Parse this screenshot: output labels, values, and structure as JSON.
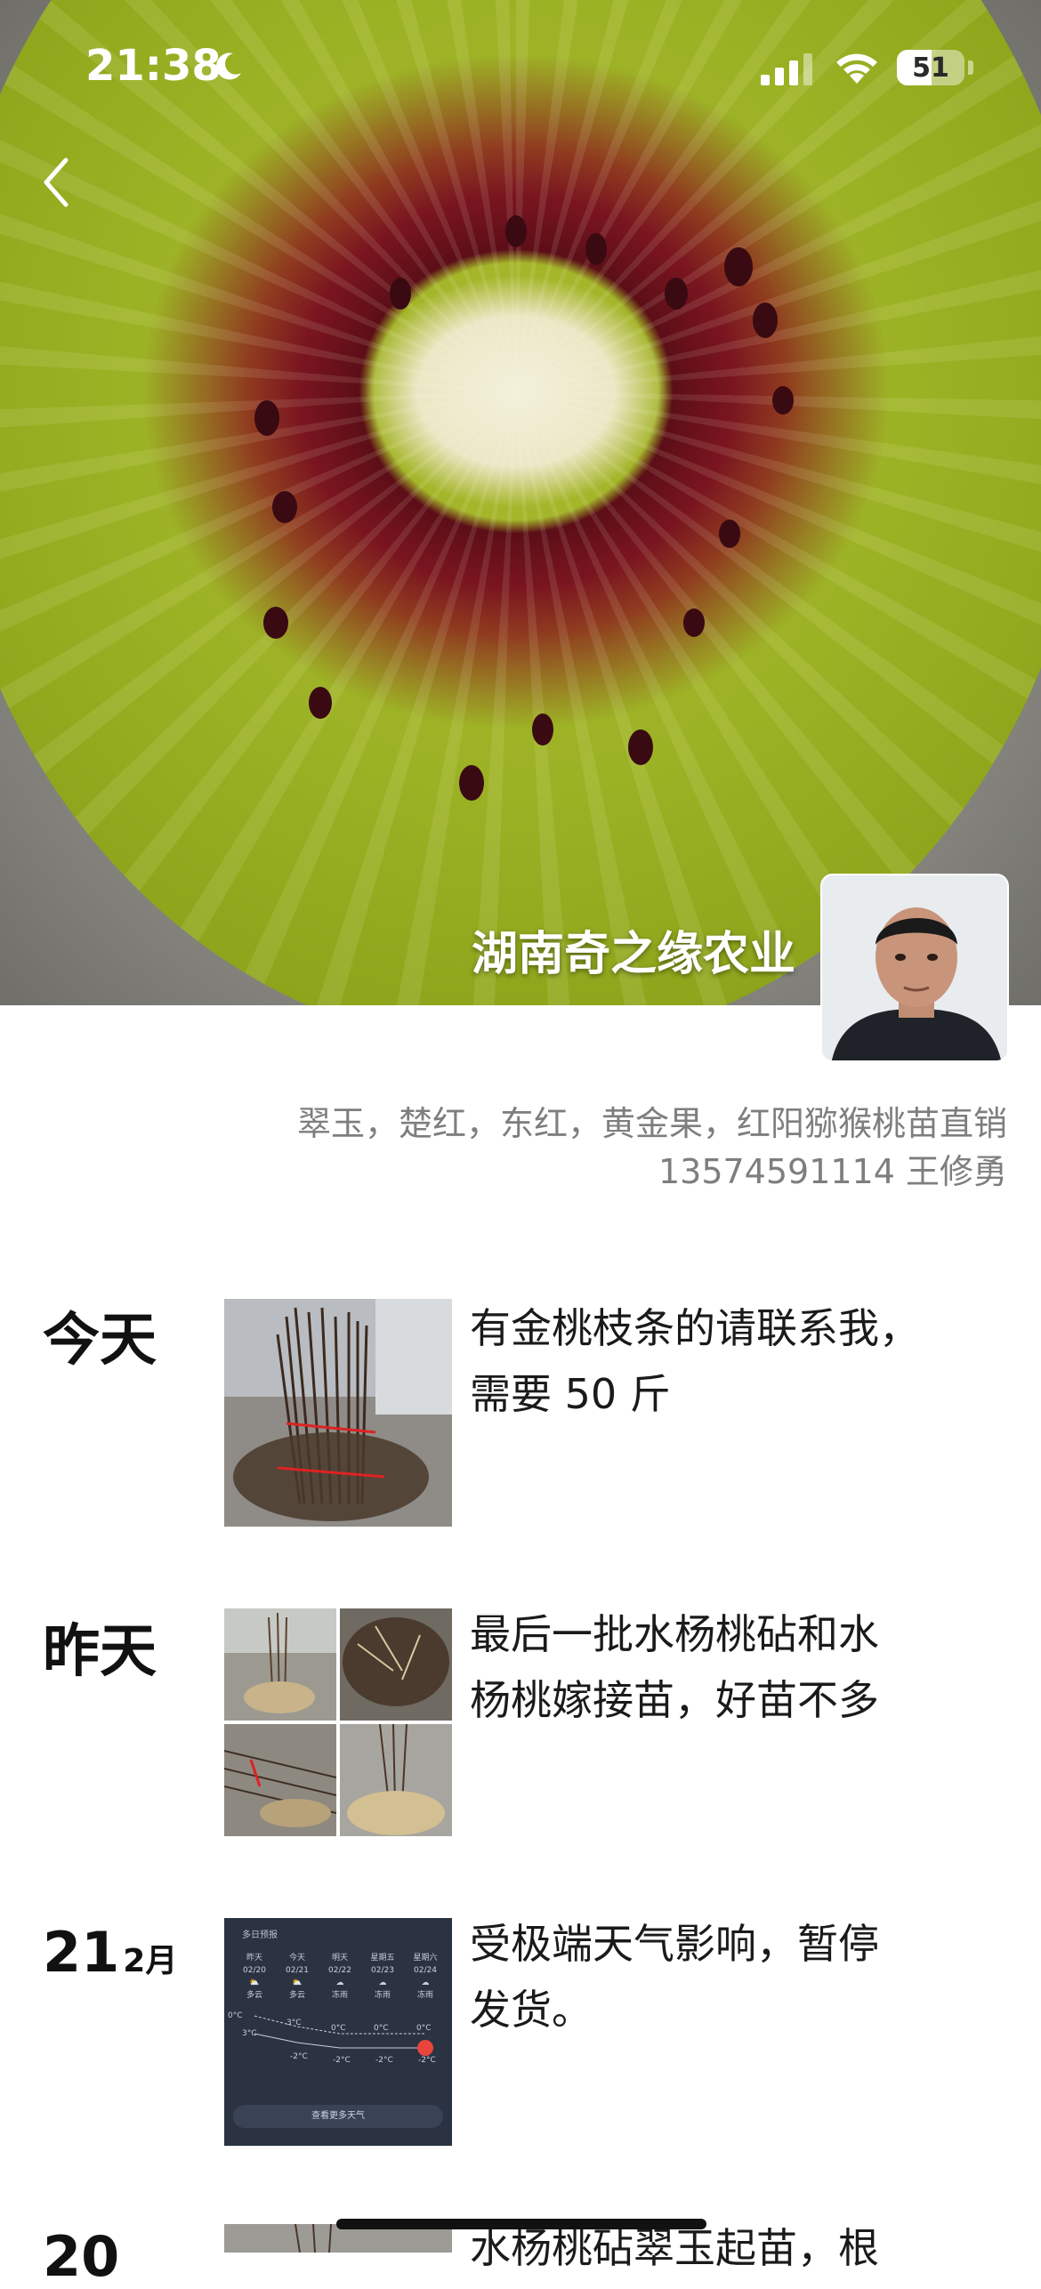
{
  "status_bar": {
    "time": "21:38",
    "battery": "51",
    "battery_level": 0.51,
    "icons": [
      "moon-icon",
      "signal-icon",
      "wifi-icon",
      "battery-icon"
    ]
  },
  "profile": {
    "name": "湖南奇之缘农业",
    "signature_line1": "翠玉，楚红，东红，黄金果，红阳猕猴桃苗直销",
    "signature_line2": "13574591114 王修勇"
  },
  "posts": [
    {
      "day": "今天",
      "text_line1": "有金桃枝条的请联系我，",
      "text_line2": "需要 50 斤"
    },
    {
      "day": "昨天",
      "text_line1": "最后一批水杨桃砧和水",
      "text_line2": "杨桃嫁接苗，好苗不多"
    },
    {
      "day_num": "21",
      "month": "2月",
      "text_line1": "受极端天气影响，暂停",
      "text_line2": "发货。"
    },
    {
      "day_num": "20",
      "text_line1": "水杨桃砧翠玉起苗，根"
    }
  ],
  "weather_thumb": {
    "title": "多日预报",
    "days": [
      "昨天",
      "今天",
      "明天",
      "星期五",
      "星期六"
    ],
    "dates": [
      "02/20",
      "02/21",
      "02/22",
      "02/23",
      "02/24"
    ],
    "conditions": [
      "多云",
      "多云",
      "冻雨",
      "冻雨",
      "冻雨"
    ],
    "highs": [
      "0°C",
      "3°C",
      "0°C",
      "0°C",
      "0°C"
    ],
    "lows": [
      "3°C",
      "-2°C",
      "-2°C",
      "-2°C",
      "-2°C"
    ],
    "button": "查看更多天气"
  },
  "colors": {
    "accent_text": "#1a1a1a",
    "signature": "#7e7e7e",
    "weather_bg": "#2b3242"
  }
}
